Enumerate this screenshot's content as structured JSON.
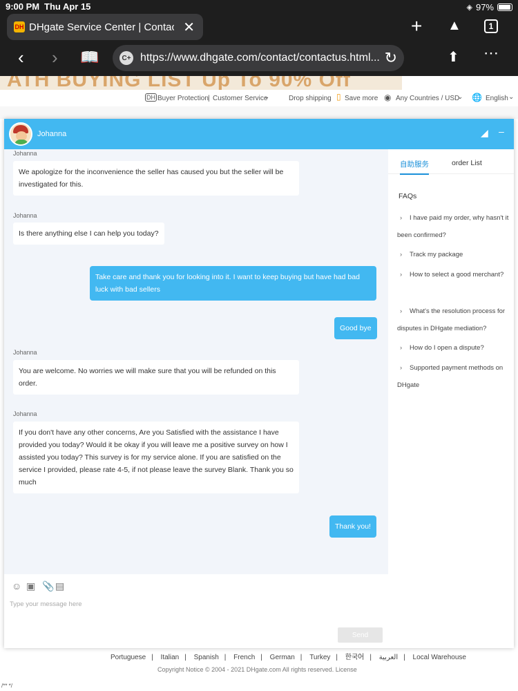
{
  "status": {
    "time": "9:00 PM",
    "date": "Thu Apr 15",
    "battery": "97%"
  },
  "browser": {
    "tab_title": "DHgate Service Center | Contact",
    "url": "https://www.dhgate.com/contact/contactus.html...",
    "tab_count": "1"
  },
  "site": {
    "banner": "ATH BUYING LIST   Up To 90% Off",
    "topbar": {
      "buyer_protection": "Buyer Protection",
      "customer_service": "Customer Service",
      "drop_shipping": "Drop shipping",
      "save_more": "Save more",
      "country": "Any Countries / USD",
      "language": "English"
    },
    "footer_links": [
      "Portuguese",
      "Italian",
      "Spanish",
      "French",
      "German",
      "Turkey",
      "한국어",
      "العربية",
      "Local Warehouse"
    ],
    "copyright": "Copyright Notice © 2004 - 2021 DHgate.com All rights reserved. License",
    "comment": "/** */"
  },
  "chat": {
    "agent_name": "Johanna",
    "messages": [
      {
        "sender": "Johanna",
        "text": "We apologize for the inconvenience the seller has caused you but the seller will be investigated for this."
      },
      {
        "sender": "Johanna",
        "text": "Is there anything else I can help you today?"
      },
      {
        "sender": "",
        "text": "Take care and thank you for looking into it. I want to keep buying but have had bad luck with bad sellers"
      },
      {
        "sender": "",
        "text": "Good bye"
      },
      {
        "sender": "Johanna",
        "text": "You are welcome. No worries we will make sure that you will be refunded on this order."
      },
      {
        "sender": "Johanna",
        "text": " If you don't have any other concerns, Are you Satisfied with the assistance I have provided you today? Would it be okay if you will leave me a positive survey  on how I assisted you today? This survey is for my service alone. If you are satisfied on the service I provided, please rate 4-5, if not please leave the survey Blank. Thank you so much"
      },
      {
        "sender": "",
        "text": "Thank you!"
      }
    ],
    "input_placeholder": "Type your message here",
    "send_label": "Send"
  },
  "faq_panel": {
    "tabs": [
      "自助服务",
      "order List"
    ],
    "title": "FAQs",
    "items": [
      "I have paid my order, why hasn't it been confirmed?",
      "Track my package",
      "How to select a good merchant?",
      "What's the resolution process for disputes in DHgate mediation?",
      "How do I open a dispute?",
      "Supported payment methods on DHgate"
    ]
  }
}
